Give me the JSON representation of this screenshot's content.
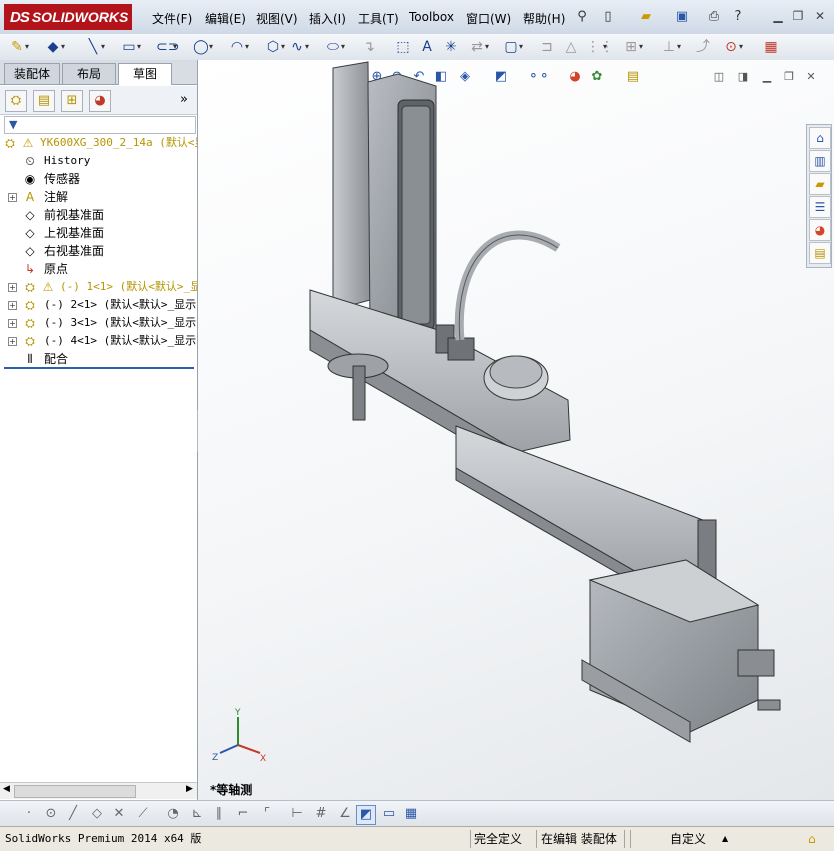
{
  "app": {
    "logo_text": "SOLIDWORKS",
    "logo_prefix": "DS"
  },
  "menu": [
    {
      "label": "文件(F)"
    },
    {
      "label": "编辑(E)"
    },
    {
      "label": "视图(V)"
    },
    {
      "label": "插入(I)"
    },
    {
      "label": "工具(T)"
    },
    {
      "label": "Toolbox"
    },
    {
      "label": "窗口(W)"
    },
    {
      "label": "帮助(H)"
    }
  ],
  "panel": {
    "tabs": [
      {
        "label": "装配体"
      },
      {
        "label": "布局"
      },
      {
        "label": "草图"
      }
    ],
    "active_tab": "草图",
    "more_symbol": "»",
    "filter_symbol": "▼"
  },
  "tree": {
    "root": "YK600XG_300_2_14a  (默认<显",
    "items": [
      {
        "label": "History"
      },
      {
        "label": "传感器"
      },
      {
        "label": "注解"
      },
      {
        "label": "前视基准面"
      },
      {
        "label": "上视基准面"
      },
      {
        "label": "右视基准面"
      },
      {
        "label": "原点"
      },
      {
        "label": "(-) 1<1> (默认<默认>_显"
      },
      {
        "label": "(-) 2<1> (默认<默认>_显示"
      },
      {
        "label": "(-) 3<1> (默认<默认>_显示"
      },
      {
        "label": "(-) 4<1> (默认<默认>_显示"
      },
      {
        "label": "配合"
      }
    ]
  },
  "viewport": {
    "view_label": "*等轴测",
    "triad": {
      "x": "X",
      "y": "Y",
      "z": "Z"
    }
  },
  "status": {
    "version": "SolidWorks Premium 2014 x64 版",
    "definition": "完全定义",
    "editing": "在编辑 装配体",
    "units": "自定义",
    "units_arrow": "▲"
  },
  "colors": {
    "logo_red": "#b3141b",
    "accent_blue": "#2f5eb0",
    "model_gray": "#9a9ea3"
  }
}
